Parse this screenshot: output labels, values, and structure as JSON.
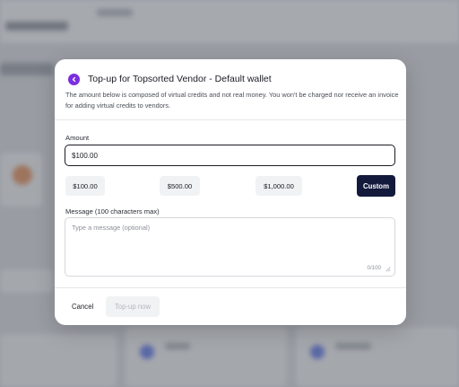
{
  "modal": {
    "title": "Top-up for Topsorted Vendor - Default wallet",
    "description": "The amount below is composed of virtual credits and not real money. You won't be charged nor receive an invoice for adding virtual credits to vendors.",
    "amount_label": "Amount",
    "amount_value": "$100.00",
    "presets": [
      "$100.00",
      "$500.00",
      "$1,000.00"
    ],
    "custom_label": "Custom",
    "message_label": "Message (100 characters max)",
    "message_placeholder": "Type a message (optional)",
    "message_counter": "0/100",
    "cancel_label": "Cancel",
    "topup_label": "Top-up now"
  },
  "colors": {
    "accent": "#7a2ee0",
    "primary_button": "#141a3c",
    "overlay": "rgba(20,24,35,0.32)"
  },
  "icons": {
    "back": "chevron-left-icon",
    "resize": "resize-handle-icon"
  }
}
